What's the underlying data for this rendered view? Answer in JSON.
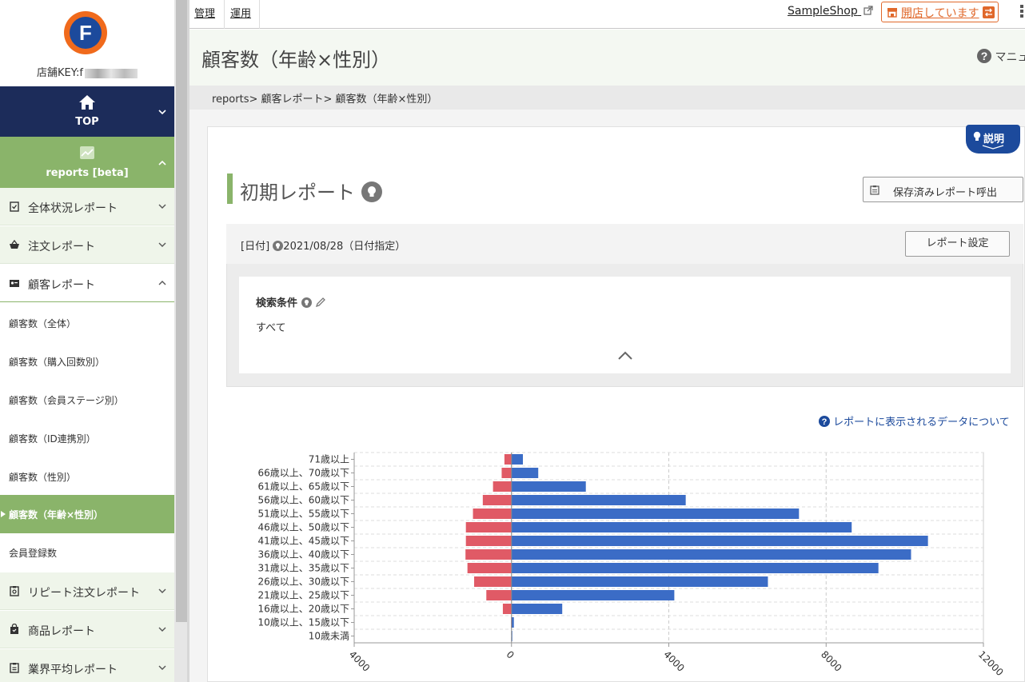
{
  "sidebar": {
    "store_key_label": "店舗KEY:f",
    "top": {
      "label": "TOP"
    },
    "reports": {
      "label": "reports [beta]"
    },
    "items": [
      {
        "label": "全体状況レポート"
      },
      {
        "label": "注文レポート"
      },
      {
        "label": "顧客レポート"
      }
    ],
    "sub_items": [
      {
        "label": "顧客数（全体）"
      },
      {
        "label": "顧客数（購入回数別）"
      },
      {
        "label": "顧客数（会員ステージ別）"
      },
      {
        "label": "顧客数（ID連携別）"
      },
      {
        "label": "顧客数（性別）"
      },
      {
        "label": "顧客数（年齢×性別）"
      },
      {
        "label": "会員登録数"
      }
    ],
    "items_after": [
      {
        "label": "リピート注文レポート"
      },
      {
        "label": "商品レポート"
      },
      {
        "label": "業界平均レポート"
      }
    ]
  },
  "topbar": {
    "nav": [
      "管理",
      "運用"
    ],
    "shop_name": "SampleShop",
    "open_status": "開店しています"
  },
  "header": {
    "title": "顧客数（年齢×性別）",
    "manual": "マニュ"
  },
  "breadcrumb": "reports> 顧客レポート> 顧客数（年齢×性別）",
  "main": {
    "explain_label": "説明",
    "report_title": "初期レポート",
    "saved_button": "保存済みレポート呼出",
    "date_prefix": "[日付]",
    "date_value": "2021/08/28（日付指定）",
    "settings_button": "レポート設定",
    "condition_title": "検索条件",
    "condition_value": "すべて",
    "data_link": "レポートに表示されるデータについて"
  },
  "colors": {
    "male": "#3b6cc6",
    "female": "#e05a66",
    "accent_green": "#8ab46a",
    "navy": "#1c2c5a"
  },
  "chart_data": {
    "type": "bar",
    "orientation": "horizontal-diverging",
    "categories": [
      "71歳以上",
      "66歳以上、70歳以下",
      "61歳以上、65歳以下",
      "56歳以上、60歳以下",
      "51歳以上、55歳以下",
      "46歳以上、50歳以下",
      "41歳以上、45歳以下",
      "36歳以上、40歳以下",
      "31歳以上、35歳以下",
      "26歳以上、30歳以下",
      "21歳以上、25歳以下",
      "16歳以上、20歳以下",
      "10歳以上、15歳以下",
      "10歳未満"
    ],
    "series": [
      {
        "values": [
          -180,
          -250,
          -470,
          -730,
          -980,
          -1160,
          -1160,
          -1170,
          -1120,
          -950,
          -640,
          -220,
          -10,
          -5
        ]
      },
      {
        "values": [
          290,
          680,
          1890,
          4430,
          7310,
          8650,
          10590,
          10160,
          9330,
          6520,
          4140,
          1290,
          60,
          20
        ]
      }
    ],
    "xlim": [
      -4000,
      12000
    ],
    "xticks": [
      "4000",
      "0",
      "4000",
      "8000",
      "12000"
    ],
    "grid": true
  }
}
